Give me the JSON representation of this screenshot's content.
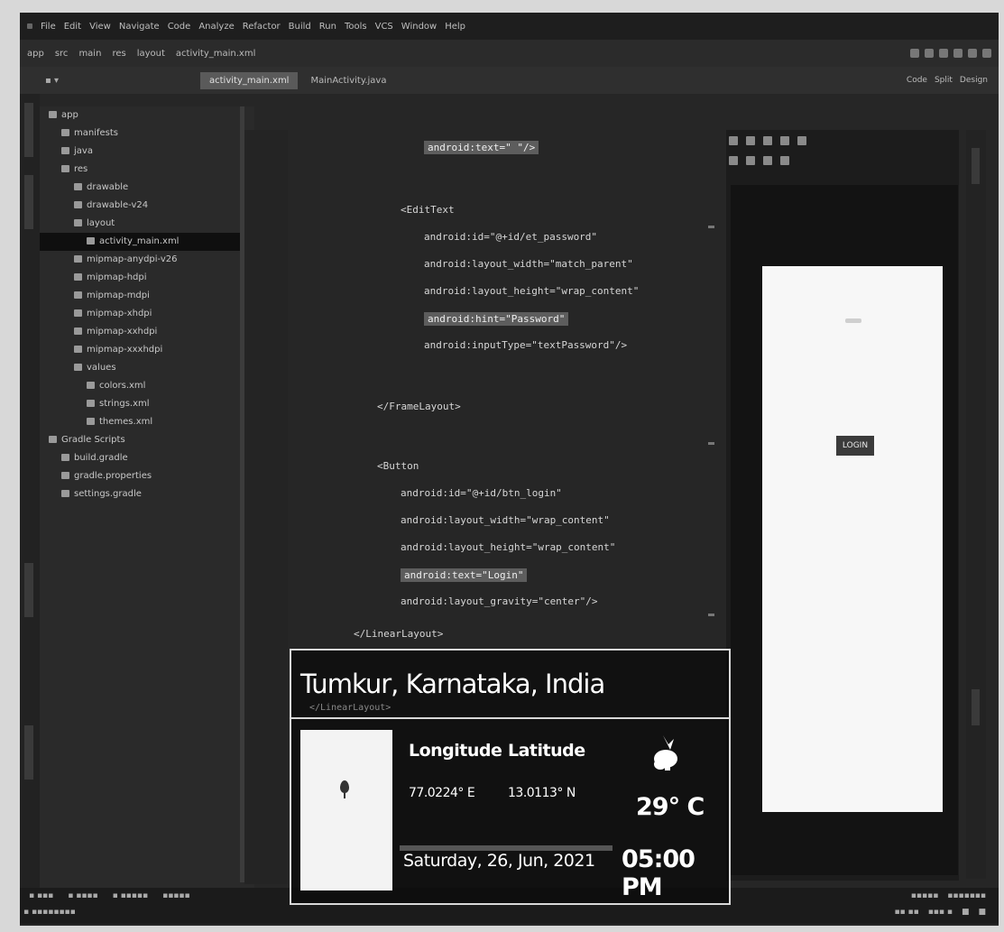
{
  "ide": {
    "menus": [
      "File",
      "Edit",
      "View",
      "Navigate",
      "Code",
      "Analyze",
      "Refactor",
      "Build",
      "Run",
      "Tools",
      "VCS",
      "Window",
      "Help"
    ],
    "nav": [
      "app",
      "src",
      "main",
      "res",
      "layout",
      "activity_main.xml"
    ],
    "tabs": [
      "activity_main.xml",
      "MainActivity.java"
    ],
    "view_modes": [
      "Code",
      "Split",
      "Design"
    ],
    "tree": [
      {
        "label": "app",
        "depth": 0
      },
      {
        "label": "manifests",
        "depth": 1
      },
      {
        "label": "java",
        "depth": 1
      },
      {
        "label": "res",
        "depth": 1
      },
      {
        "label": "drawable",
        "depth": 2
      },
      {
        "label": "drawable-v24",
        "depth": 2
      },
      {
        "label": "layout",
        "depth": 2
      },
      {
        "label": "activity_main.xml",
        "depth": 3,
        "selected": true
      },
      {
        "label": "mipmap-anydpi-v26",
        "depth": 2
      },
      {
        "label": "mipmap-hdpi",
        "depth": 2
      },
      {
        "label": "mipmap-mdpi",
        "depth": 2
      },
      {
        "label": "mipmap-xhdpi",
        "depth": 2
      },
      {
        "label": "mipmap-xxhdpi",
        "depth": 2
      },
      {
        "label": "mipmap-xxxhdpi",
        "depth": 2
      },
      {
        "label": "values",
        "depth": 2
      },
      {
        "label": "colors.xml",
        "depth": 3
      },
      {
        "label": "strings.xml",
        "depth": 3
      },
      {
        "label": "themes.xml",
        "depth": 3
      },
      {
        "label": "Gradle Scripts",
        "depth": 0
      },
      {
        "label": "build.gradle",
        "depth": 1
      },
      {
        "label": "gradle.properties",
        "depth": 1
      },
      {
        "label": "settings.gradle",
        "depth": 1
      }
    ],
    "code": [
      {
        "indent": 10,
        "text": "android:text=\"                \"/>"
      },
      {
        "indent": 8,
        "text": "<EditText"
      },
      {
        "indent": 10,
        "text": "android:id=\"@+id/et_password\""
      },
      {
        "indent": 10,
        "text": "android:layout_width=\"match_parent\""
      },
      {
        "indent": 10,
        "text": "android:layout_height=\"wrap_content\""
      },
      {
        "indent": 10,
        "text": "android:hint=\"Password\""
      },
      {
        "indent": 10,
        "text": "android:inputType=\"textPassword\"/>"
      },
      {
        "indent": 6,
        "text": "</FrameLayout>"
      },
      {
        "indent": 6,
        "text": "<Button"
      },
      {
        "indent": 8,
        "text": "android:id=\"@+id/btn_login\""
      },
      {
        "indent": 8,
        "text": "android:layout_width=\"wrap_content\""
      },
      {
        "indent": 8,
        "text": "android:layout_height=\"wrap_content\""
      },
      {
        "indent": 8,
        "text": "android:text=\"Login\""
      },
      {
        "indent": 8,
        "text": "android:layout_gravity=\"center\"/>"
      },
      {
        "indent": 4,
        "text": "</LinearLayout>"
      }
    ],
    "preview_button": "LOGIN"
  },
  "geotag": {
    "location": "Tumkur, Karnataka, India",
    "longitude_label": "Longitude",
    "latitude_label": "Latitude",
    "longitude": "77.0224° E",
    "latitude": "13.0113° N",
    "temperature": "29° C",
    "date": "Saturday, 26, Jun, 2021",
    "time": "05:00 PM",
    "weather_icon": "partly-cloudy-icon"
  }
}
